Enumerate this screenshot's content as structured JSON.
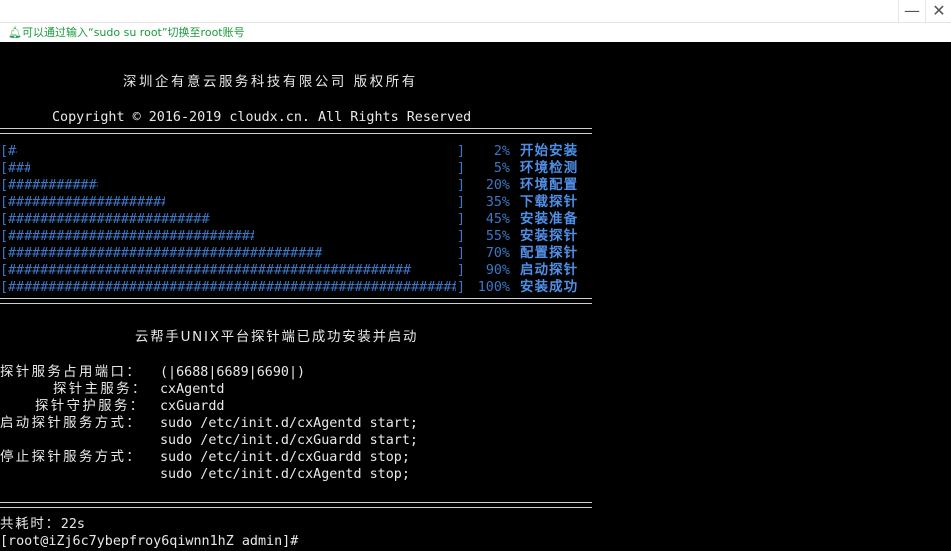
{
  "window": {
    "minimize_glyph": "—",
    "close_glyph": "✕"
  },
  "hint": {
    "icon": "bell-icon",
    "text": "可以通过输入“sudo su root”切换至root账号",
    "color": "#1a9a3c"
  },
  "terminal": {
    "header_company": "深圳企有意云服务科技有限公司 版权所有",
    "header_copyright": "Copyright © 2016-2019 cloudx.cn. All Rights Reserved",
    "progress": [
      {
        "percent": 2,
        "percent_text": "2%",
        "label": "开始安装"
      },
      {
        "percent": 5,
        "percent_text": "5%",
        "label": "环境检测"
      },
      {
        "percent": 20,
        "percent_text": "20%",
        "label": "环境配置"
      },
      {
        "percent": 35,
        "percent_text": "35%",
        "label": "下载探针"
      },
      {
        "percent": 45,
        "percent_text": "45%",
        "label": "安装准备"
      },
      {
        "percent": 55,
        "percent_text": "55%",
        "label": "安装探针"
      },
      {
        "percent": 70,
        "percent_text": "70%",
        "label": "配置探针"
      },
      {
        "percent": 90,
        "percent_text": "90%",
        "label": "启动探针"
      },
      {
        "percent": 100,
        "percent_text": "100%",
        "label": "安装成功"
      }
    ],
    "success_message": "云帮手UNIX平台探针端已成功安装并启动",
    "port_label": "探针服务占用端口：",
    "port_value": "(|6688|6689|6690|)",
    "main_service_label": "探针主服务：",
    "main_service_value": "cxAgentd",
    "guard_service_label": "探针守护服务：",
    "guard_service_value": "cxGuardd",
    "start_label": "启动探针服务方式：",
    "start_cmd_1": "sudo /etc/init.d/cxAgentd start;",
    "start_cmd_2": "sudo /etc/init.d/cxGuardd start;",
    "stop_label": "停止探针服务方式：",
    "stop_cmd_1": "sudo /etc/init.d/cxGuardd stop;",
    "stop_cmd_2": "sudo /etc/init.d/cxAgentd stop;",
    "elapsed_label": "共耗时：",
    "elapsed_value": "22s",
    "prompt": "[root@iZj6c7ybepfroy6qiwnn1hZ admin]#"
  },
  "colors": {
    "background": "#000000",
    "text": "#e8e8e8",
    "progress": "#3b78c8",
    "progress_label": "#4f8fe6"
  }
}
